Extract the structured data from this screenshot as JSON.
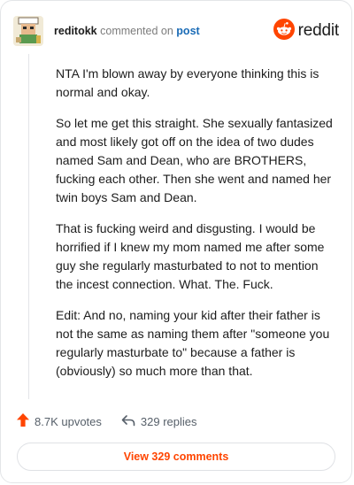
{
  "header": {
    "username": "reditokk",
    "action_text": "commented on",
    "post_link": "post",
    "brand": "reddit"
  },
  "comment": {
    "paragraphs": [
      "NTA I'm blown away by everyone thinking this is normal and okay.",
      "So let me get this straight. She sexually fantasized and most likely got off on the idea of two dudes named Sam and Dean, who are BROTHERS, fucking each other. Then she went and named her twin boys Sam and Dean.",
      "That is fucking weird and disgusting. I would be horrified if I knew my mom named me after some guy she regularly masturbated to not to mention the incest connection. What. The. Fuck.",
      "Edit: And no, naming your kid after their father is not the same as naming them after \"someone you regularly masturbate to\" because a father is (obviously) so much more than that."
    ]
  },
  "footer": {
    "upvotes": "8.7K upvotes",
    "replies": "329 replies",
    "view_button": "View 329 comments"
  },
  "icons": {
    "upvote": "upvote-arrow-icon",
    "reply": "reply-arrow-icon",
    "brand": "reddit-snoo-icon"
  },
  "colors": {
    "accent": "#ff4500",
    "link": "#1a6bb6"
  }
}
